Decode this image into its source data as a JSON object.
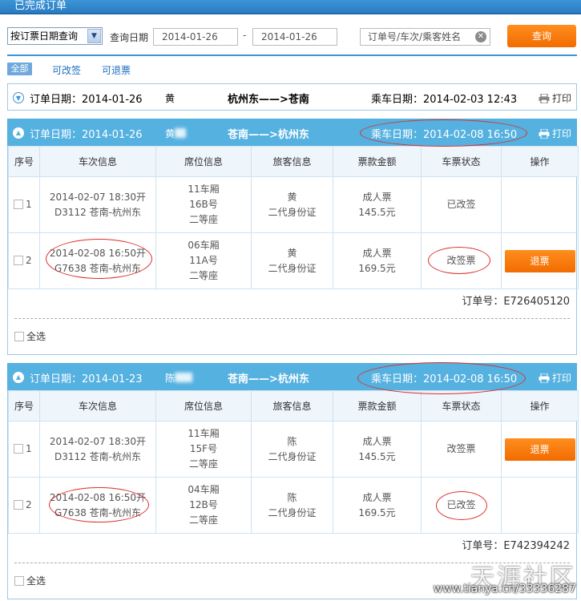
{
  "page": {
    "title": "已完成订单"
  },
  "search": {
    "mode": "按订票日期查询",
    "date_label": "查询日期",
    "date_from": "2014-01-26",
    "date_sep": "-",
    "date_to": "2014-01-26",
    "keyword_placeholder": "订单号/车次/乘客姓名",
    "query_label": "查询"
  },
  "filters": {
    "all": "全部",
    "changeable": "可改签",
    "refundable": "可退票"
  },
  "print_label": "打印",
  "columns": [
    "序号",
    "车次信息",
    "席位信息",
    "旅客信息",
    "票款金额",
    "车票状态",
    "操作"
  ],
  "select_all": "全选",
  "collapsed_order": {
    "order_date": "订单日期：2014-01-26",
    "passenger": "黄",
    "route": "杭州东——>苍南",
    "travel_date": "乘车日期：2014-02-03 12:43"
  },
  "orders": [
    {
      "order_date": "订单日期：2014-01-26",
      "passenger": "黄",
      "route": "苍南——>杭州东",
      "travel_date": "乘车日期：2014-02-08 16:50",
      "order_no": "订单号：E726405120",
      "rows": [
        {
          "seq": "1",
          "train1": "2014-02-07 18:30开",
          "train2": "D3112 苍南-杭州东",
          "seat1": "11车厢",
          "seat2": "16B号",
          "seat3": "二等座",
          "pax1": "黄",
          "pax2": "二代身份证",
          "price1": "成人票",
          "price2": "145.5元",
          "status": "已改签",
          "action": ""
        },
        {
          "seq": "2",
          "train1": "2014-02-08 16:50开",
          "train2": "G7638 苍南-杭州东",
          "seat1": "06车厢",
          "seat2": "11A号",
          "seat3": "二等座",
          "pax1": "黄",
          "pax2": "二代身份证",
          "price1": "成人票",
          "price2": "169.5元",
          "status": "改签票",
          "action": "退票"
        }
      ]
    },
    {
      "order_date": "订单日期：2014-01-23",
      "passenger": "陈",
      "route": "苍南——>杭州东",
      "travel_date": "乘车日期：2014-02-08 16:50",
      "order_no": "订单号：E742394242",
      "rows": [
        {
          "seq": "1",
          "train1": "2014-02-07 18:30开",
          "train2": "D3112 苍南-杭州东",
          "seat1": "11车厢",
          "seat2": "15F号",
          "seat3": "二等座",
          "pax1": "陈",
          "pax2": "二代身份证",
          "price1": "成人票",
          "price2": "145.5元",
          "status": "改签票",
          "action": "退票"
        },
        {
          "seq": "2",
          "train1": "2014-02-08 16:50开",
          "train2": "G7638 苍南-杭州东",
          "seat1": "04车厢",
          "seat2": "12B号",
          "seat3": "二等座",
          "pax1": "陈",
          "pax2": "二代身份证",
          "price1": "成人票",
          "price2": "169.5元",
          "status": "已改签",
          "action": ""
        }
      ]
    }
  ],
  "watermark": {
    "brand": "天涯社区",
    "url": "www.tianya.cn/33336287"
  },
  "colors": {
    "accent": "#3c95d6",
    "header": "#55b1e0",
    "button": "#f57a0a",
    "annotation": "#d9302d"
  }
}
